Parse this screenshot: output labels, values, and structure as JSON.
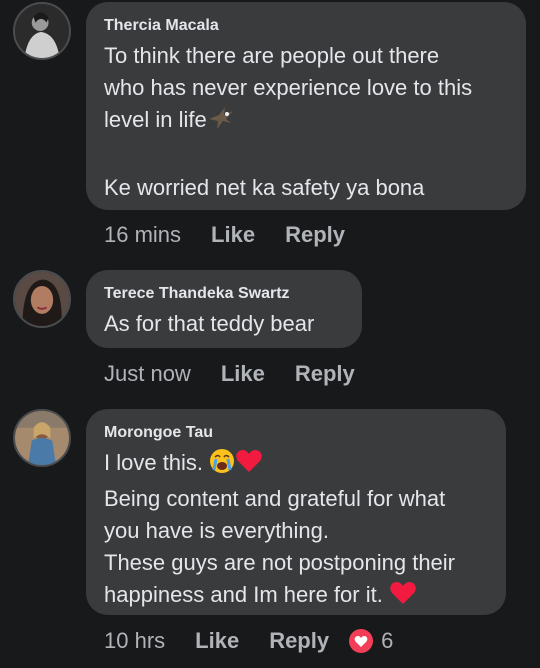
{
  "comments": [
    {
      "author": "Thercia Macala",
      "lines": [
        "To think there are people out there",
        "who has never experience love to this",
        "level in life"
      ],
      "line_after_gap": "Ke worried net ka safety ya bona",
      "time": "16 mins",
      "like": "Like",
      "reply": "Reply"
    },
    {
      "author": "Terece Thandeka Swartz",
      "lines": [
        "As for that teddy bear"
      ],
      "time": "Just now",
      "like": "Like",
      "reply": "Reply"
    },
    {
      "author": "Morongoe Tau",
      "lines": [
        "I love this.",
        "Being content and grateful for what",
        "you have is everything.",
        "These guys are not postponing their",
        "happiness and Im here for it."
      ],
      "time": "10 hrs",
      "like": "Like",
      "reply": "Reply",
      "reaction_count": "6"
    }
  ],
  "colors": {
    "background": "#18191a",
    "bubble": "#3a3b3c",
    "text": "#e4e6eb",
    "secondary_text": "#b0b3b8",
    "heart": "#f33e58"
  },
  "icons": {
    "eagle": "eagle-emoji",
    "crying_face": "crying-face-emoji",
    "red_heart": "red-heart-emoji",
    "love_reaction": "heart-reaction-icon"
  }
}
